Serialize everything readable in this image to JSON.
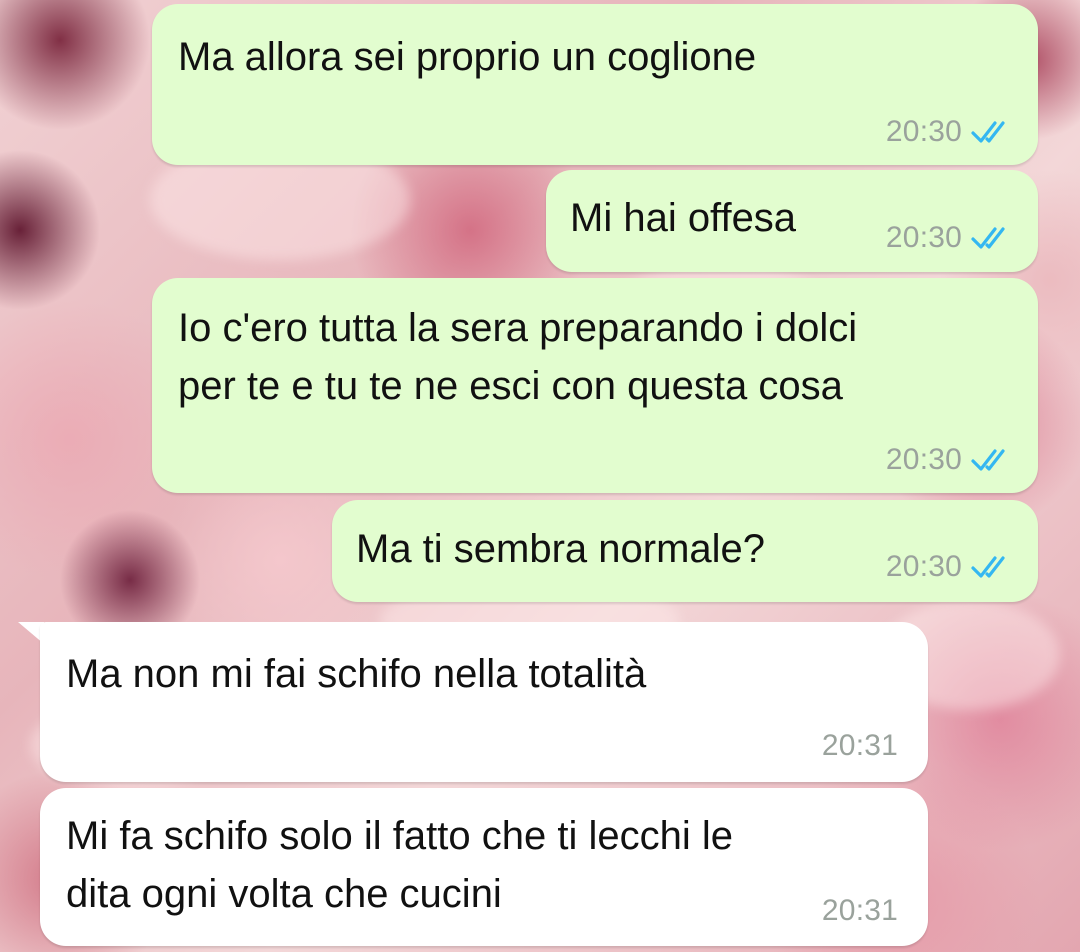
{
  "conversation": {
    "messages": [
      {
        "direction": "outgoing",
        "text": "Ma allora sei proprio un coglione",
        "time": "20:30",
        "status": "read"
      },
      {
        "direction": "outgoing",
        "text": "Mi hai offesa",
        "time": "20:30",
        "status": "read"
      },
      {
        "direction": "outgoing",
        "text": "Io c'ero tutta la sera preparando i dolci\nper te e tu te ne esci con questa cosa",
        "time": "20:30",
        "status": "read"
      },
      {
        "direction": "outgoing",
        "text": "Ma ti sembra normale?",
        "time": "20:30",
        "status": "read"
      },
      {
        "direction": "incoming",
        "text": "Ma non mi fai schifo nella totalità",
        "time": "20:31"
      },
      {
        "direction": "incoming",
        "text": "Mi fa schifo solo il fatto che ti lecchi le\ndita ogni volta che cucini",
        "time": "20:31"
      }
    ]
  },
  "icons": {
    "read_receipt": "double-check-icon"
  },
  "colors": {
    "outgoing_bubble": "#e2fdcf",
    "incoming_bubble": "#ffffff",
    "read_tick": "#34b7f1",
    "time_text": "#9aa29c"
  }
}
